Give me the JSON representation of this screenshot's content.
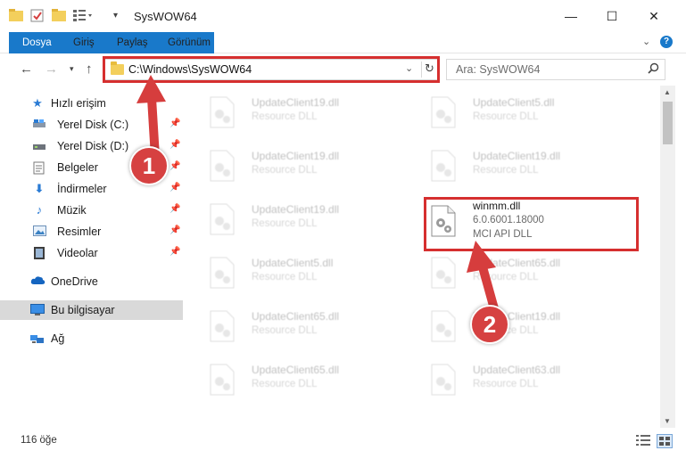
{
  "window": {
    "title": "SysWOW64",
    "minimize": "—",
    "maximize": "☐",
    "close": "✕"
  },
  "ribbon": {
    "tabs": [
      "Dosya",
      "Giriş",
      "Paylaş",
      "Görünüm"
    ]
  },
  "address": {
    "path": "C:\\Windows\\SysWOW64",
    "search_placeholder": "Ara: SysWOW64"
  },
  "sidebar": {
    "items": [
      {
        "label": "Hızlı erişim",
        "icon": "star-icon"
      },
      {
        "label": "Yerel Disk (C:)",
        "icon": "drive-icon"
      },
      {
        "label": "Yerel Disk (D:)",
        "icon": "drive-icon"
      },
      {
        "label": "Belgeler",
        "icon": "documents-icon"
      },
      {
        "label": "İndirmeler",
        "icon": "download-icon"
      },
      {
        "label": "Müzik",
        "icon": "music-icon"
      },
      {
        "label": "Resimler",
        "icon": "pictures-icon"
      },
      {
        "label": "Videolar",
        "icon": "videos-icon"
      },
      {
        "label": "OneDrive",
        "icon": "cloud-icon"
      },
      {
        "label": "Bu bilgisayar",
        "icon": "computer-icon"
      },
      {
        "label": "Ağ",
        "icon": "network-icon"
      }
    ]
  },
  "files": [
    {
      "name": "UpdateClient19.dll",
      "type": "Resource DLL"
    },
    {
      "name": "UpdateClient5.dll",
      "type": "Resource DLL"
    },
    {
      "name": "UpdateClient19.dll",
      "type": "Resource DLL"
    },
    {
      "name": "UpdateClient19.dll",
      "type": "Resource DLL"
    },
    {
      "name": "UpdateClient19.dll",
      "type": "Resource DLL"
    },
    {
      "name": "winmm.dll",
      "version": "6.0.6001.18000",
      "type": "MCI API DLL"
    },
    {
      "name": "UpdateClient5.dll",
      "type": "Resource DLL"
    },
    {
      "name": "UpdateClient65.dll",
      "type": "Resource DLL"
    },
    {
      "name": "UpdateClient65.dll",
      "type": "Resource DLL"
    },
    {
      "name": "UpdateClient19.dll",
      "type": "Resource DLL"
    },
    {
      "name": "UpdateClient65.dll",
      "type": "Resource DLL"
    },
    {
      "name": "UpdateClient63.dll",
      "type": "Resource DLL"
    }
  ],
  "status": {
    "count": "116 öğe"
  },
  "annotations": {
    "step1": "1",
    "step2": "2"
  },
  "colors": {
    "accent": "#1979ca",
    "highlight": "#d62f2f",
    "folder": "#f3cf5c"
  }
}
